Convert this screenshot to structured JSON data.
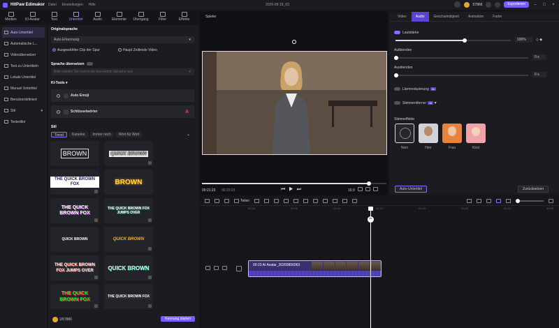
{
  "titlebar": {
    "app_name": "HitPaw Edimakor",
    "menus": [
      "Datei",
      "Einstellungen",
      "Hilfe"
    ],
    "doc_title": "2026-08-18_03",
    "credits": "57866",
    "export_label": "Exportieren"
  },
  "toolbar": [
    {
      "label": "Medien",
      "icon": "media-icon"
    },
    {
      "label": "KI-Avatar",
      "icon": "avatar-icon"
    },
    {
      "label": "Text",
      "icon": "text-icon"
    },
    {
      "label": "Untertitel",
      "icon": "subtitle-icon",
      "active": true
    },
    {
      "label": "Audio",
      "icon": "audio-icon"
    },
    {
      "label": "Elemente",
      "icon": "elements-icon"
    },
    {
      "label": "Übergang",
      "icon": "transition-icon"
    },
    {
      "label": "Filter",
      "icon": "filter-icon"
    },
    {
      "label": "Effekte",
      "icon": "effects-icon"
    }
  ],
  "sidebar": [
    {
      "label": "Auto-Untertitel",
      "active": true
    },
    {
      "label": "Automatische L..."
    },
    {
      "label": "Videoübersetzer"
    },
    {
      "label": "Text zu Untertiteln"
    },
    {
      "label": "Lokale Untertitel"
    },
    {
      "label": "Manuel Untertitel"
    },
    {
      "label": "Benutzerdefiniert"
    },
    {
      "label": "Stil"
    },
    {
      "label": "Testeditor"
    }
  ],
  "panel": {
    "orig_lang_title": "Originalsprache",
    "orig_lang_value": "Auto-Erkennung",
    "radio1": "Ausgewählter Clip der Spur",
    "radio2": "Haupt Zeitleiste Video",
    "translate_title": "Sprache übersetzen",
    "translate_placeholder": "Bitte wählen Sie zuerst die übersetzte Sprache aus",
    "kitools_title": "KI-Tools",
    "auto_emoji": "Auto Emoji",
    "keyword": "Schlüsselwörter",
    "style_title": "Stil",
    "style_tabs": [
      "Trend",
      "Karaoke",
      "Immer noch",
      "Wort für Wort"
    ],
    "tiles": [
      "BROWN",
      "QUICK BROWN",
      "THE QUICK BROWN FOX",
      "BROWN",
      "THE QUICK BROWN FOX",
      "THE QUICK BROWN FOX JUMPS OVER",
      "QUICK BROWN",
      "QUICK BROWN",
      "THE QUICK BROWN FOX JUMPS OVER",
      "QUICK BROWN",
      "THE QUICK BROWN FOX",
      "THE QUICK BROWN FOX"
    ],
    "credits": "1/57866",
    "start_label": "Kennung starten"
  },
  "player": {
    "title": "Spieler",
    "time_current": "00:21:23",
    "time_total": "00:23:23",
    "ratio": "16:9"
  },
  "right": {
    "tabs": [
      "Video",
      "Audio",
      "Geschwindigkeit",
      "Animation",
      "Farbe"
    ],
    "active_tab": "Audio",
    "volume_label": "Lautstärke",
    "volume_value": "100%",
    "volume_level": 1.0,
    "fadein_label": "Aufblenden",
    "fadein_value": "0 s",
    "fadeout_label": "Ausblenden",
    "fadeout_value": "0 s",
    "noise_label": "Lärmreduzierung",
    "voice_remover_label": "Stimmentferner",
    "ai_badge": "AI",
    "voice_fx_label": "Stimmeffekte",
    "voices": [
      "Nein",
      "Herr",
      "Frau",
      "Kind"
    ],
    "auto_sub_btn": "Auto-Untertitel",
    "reset_btn": "Zurücksetzen"
  },
  "timeline": {
    "split_label": "Teilen",
    "clip_label": "00:23 AI Avatar_20260806063",
    "ticks": [
      "00:00",
      "00:05",
      "00:10",
      "00:15",
      "00:20",
      "00:25",
      "00:30",
      "00:35"
    ]
  }
}
